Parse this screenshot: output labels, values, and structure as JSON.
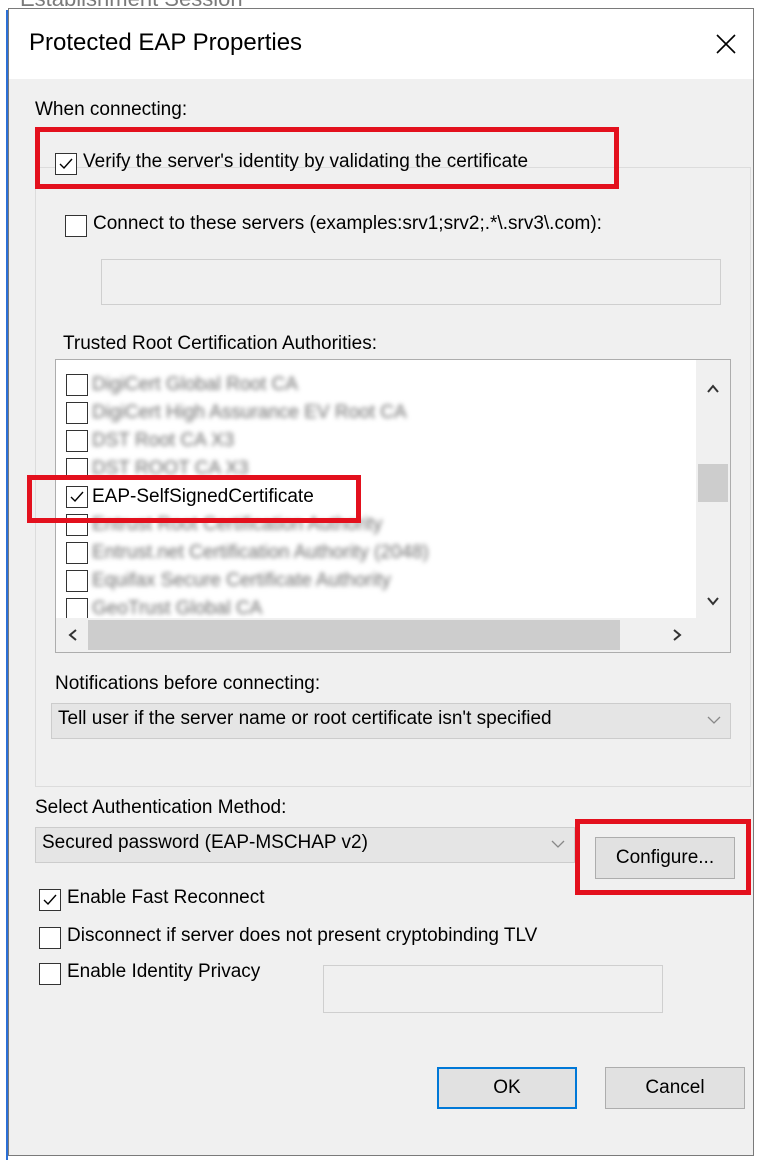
{
  "background_window": {
    "title_fragment": "Establishment Session"
  },
  "dialog": {
    "title": "Protected EAP Properties",
    "close_glyph": "×"
  },
  "when_connecting": {
    "label": "When connecting:",
    "verify_checkbox": {
      "label": "Verify the server's identity by validating the certificate",
      "checked": true
    },
    "connect_servers_checkbox": {
      "label": "Connect to these servers (examples:srv1;srv2;.*\\.srv3\\.com):",
      "checked": false
    },
    "servers_field": {
      "value": ""
    },
    "trusted_root_label": "Trusted Root Certification Authorities:",
    "certificates": [
      {
        "label": "DigiCert Global Root CA",
        "checked": false,
        "obscured": true
      },
      {
        "label": "DigiCert High Assurance EV Root CA",
        "checked": false,
        "obscured": true
      },
      {
        "label": "DST Root CA X3",
        "checked": false,
        "obscured": true
      },
      {
        "label": "DST ROOT CA X3",
        "checked": false,
        "obscured": true
      },
      {
        "label": "EAP-SelfSignedCertificate",
        "checked": true,
        "obscured": false
      },
      {
        "label": "Entrust Root Certification Authority",
        "checked": false,
        "obscured": true
      },
      {
        "label": "Entrust.net Certification Authority (2048)",
        "checked": false,
        "obscured": true
      },
      {
        "label": "Equifax Secure Certificate Authority",
        "checked": false,
        "obscured": true
      },
      {
        "label": "GeoTrust Global CA",
        "checked": false,
        "obscured": true
      }
    ],
    "notifications_label": "Notifications before connecting:",
    "notifications_value": "Tell user if the server name or root certificate isn't specified"
  },
  "auth": {
    "label": "Select Authentication Method:",
    "method_value": "Secured password (EAP-MSCHAP v2)",
    "configure_button": "Configure...",
    "fast_reconnect": {
      "label": "Enable Fast Reconnect",
      "checked": true
    },
    "cryptobinding": {
      "label": "Disconnect if server does not present cryptobinding TLV",
      "checked": false
    },
    "identity_privacy": {
      "label": "Enable Identity Privacy",
      "checked": false
    },
    "identity_field": {
      "value": ""
    }
  },
  "buttons": {
    "ok": "OK",
    "cancel": "Cancel"
  },
  "colors": {
    "highlight_red": "#e3101d",
    "dialog_bg": "#f0f0f0",
    "focus_blue": "#0078d7"
  },
  "icons": {
    "close": "close-icon",
    "check": "checkmark-icon",
    "scroll_up": "chevron-up-icon",
    "scroll_down": "chevron-down-icon",
    "scroll_left": "chevron-left-icon",
    "scroll_right": "chevron-right-icon",
    "dropdown": "chevron-down-icon"
  }
}
